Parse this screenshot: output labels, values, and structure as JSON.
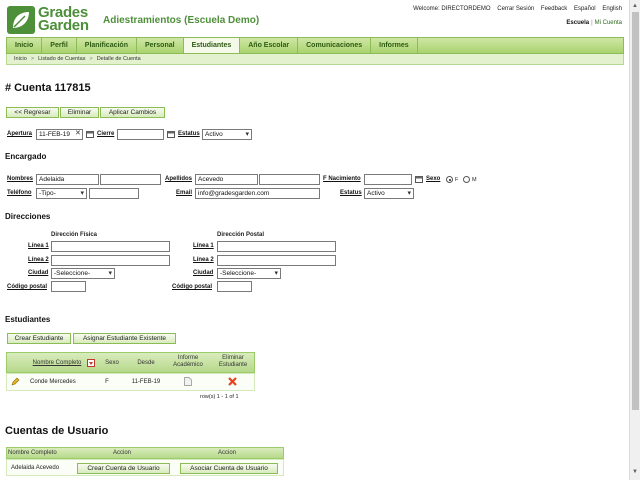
{
  "header": {
    "logo_line1": "Grades",
    "logo_line2": "Garden",
    "app_title": "Adiestramientos (Escuela Demo)",
    "top_links": [
      "Welcome: DIRECTORDEMO",
      "Cerrar Sesión",
      "Feedback",
      "Español",
      "English"
    ],
    "scope_current": "Escuela",
    "scope_other": "Mi Cuenta"
  },
  "nav": {
    "tabs": [
      "Inicio",
      "Perfil",
      "Planificación",
      "Personal",
      "Estudiantes",
      "Año Escolar",
      "Comunicaciones",
      "Informes"
    ],
    "active": "Estudiantes"
  },
  "breadcrumb": [
    "Inicio",
    "Listado de Cuentas",
    "Detalle de Cuenta"
  ],
  "page_title": "# Cuenta 117815",
  "actions": {
    "back": "<< Regresar",
    "delete": "Eliminar",
    "apply": "Aplicar Cambios"
  },
  "account": {
    "apertura_label": "Apertura",
    "apertura_value": "11-FEB-19",
    "cierre_label": "Cierre",
    "cierre_value": "",
    "estatus_label": "Estatus",
    "estatus_value": "Activo"
  },
  "encargado": {
    "title": "Encargado",
    "nombres_label": "Nombres",
    "nombres_value": "Adelaida",
    "nombres_value2": "",
    "apellidos_label": "Apellidos",
    "apellidos_value": "Acevedo",
    "apellidos_value2": "",
    "nacimiento_label": "F Nacimiento",
    "nacimiento_value": "",
    "sexo_label": "Sexo",
    "sexo_f": "F",
    "sexo_m": "M",
    "telefono_label": "Teléfono",
    "telefono_tipo": "-Tipo-",
    "telefono_value": "",
    "email_label": "Email",
    "email_value": "info@gradesgarden.com",
    "estatus_label": "Estatus",
    "estatus_value": "Activo"
  },
  "direcciones": {
    "title": "Direcciones",
    "fisica_title": "Dirección Física",
    "postal_title": "Dirección Postal",
    "linea1_label": "Línea 1",
    "linea2_label": "Línea 2",
    "ciudad_label": "Ciudad",
    "ciudad_value": "-Seleccione-",
    "postal_label": "Código postal",
    "fisica": {
      "linea1": "",
      "linea2": "",
      "codigo": ""
    },
    "postal": {
      "linea1": "",
      "linea2": "",
      "codigo": ""
    }
  },
  "estudiantes": {
    "title": "Estudiantes",
    "create_btn": "Crear Estudiante",
    "assign_btn": "Asignar Estudiante Existente",
    "columns": [
      "Nombre Completo",
      "Sexo",
      "Desde",
      "Informe Académico",
      "Eliminar Estudiante"
    ],
    "rows": [
      {
        "nombre": "Conde Mercedes",
        "sexo": "F",
        "desde": "11-FEB-19"
      }
    ],
    "pagination": "row(s) 1 - 1 of 1"
  },
  "cuentas_usuario": {
    "title": "Cuentas de Usuario",
    "columns": [
      "Nombre Completo",
      "Accion",
      "Accion"
    ],
    "rows": [
      {
        "nombre": "Adelaida Acevedo",
        "action1": "Crear Cuenta de Usuario",
        "action2": "Asociar Cuenta de Usuario"
      }
    ]
  },
  "colors": {
    "brand_green": "#4e8f3a",
    "nav_green": "#a9d36e",
    "delete_red": "#e8431e"
  }
}
